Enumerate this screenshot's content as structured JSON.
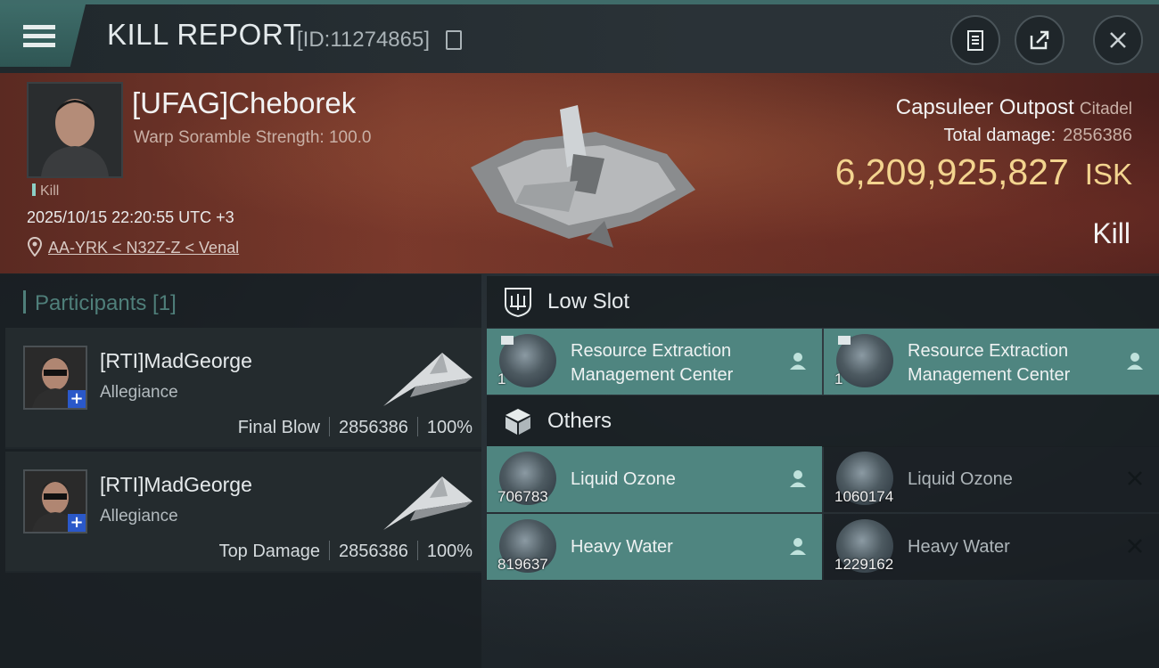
{
  "header": {
    "title": "KILL REPORT",
    "id_text": "[ID:11274865]",
    "icons": [
      "menu-icon",
      "copy-icon",
      "clipboard-icon",
      "share-icon",
      "close-icon"
    ]
  },
  "victim": {
    "name": "[UFAG]Cheborek",
    "stat_line": "Warp Soramble Strength: 100.0",
    "tag": "Kill",
    "datetime": "2025/10/15 22:20:55 UTC +3",
    "location": "AA-YRK < N32Z-Z < Venal"
  },
  "ship": {
    "name": "Capsuleer Outpost",
    "class": "Citadel",
    "total_damage_label": "Total damage:",
    "total_damage": "2856386",
    "isk_value": "6,209,925,827",
    "isk_unit": "ISK",
    "result": "Kill"
  },
  "participants": {
    "header": "Participants [1]",
    "cards": [
      {
        "name": "[RTI]MadGeorge",
        "corp": "Allegiance",
        "role": "Final Blow",
        "damage": "2856386",
        "percent": "100%"
      },
      {
        "name": "[RTI]MadGeorge",
        "corp": "Allegiance",
        "role": "Top Damage",
        "damage": "2856386",
        "percent": "100%"
      }
    ]
  },
  "low_slot": {
    "header": "Low Slot",
    "items": [
      {
        "line1": "Resource Extraction",
        "line2": "Management Center",
        "qty": "1",
        "state": "dropped"
      },
      {
        "line1": "Resource Extraction",
        "line2": "Management Center",
        "qty": "1",
        "state": "dropped"
      }
    ]
  },
  "others": {
    "header": "Others",
    "items": [
      {
        "name": "Liquid Ozone",
        "qty": "706783",
        "state": "dropped"
      },
      {
        "name": "Liquid Ozone",
        "qty": "1060174",
        "state": "destroyed"
      },
      {
        "name": "Heavy Water",
        "qty": "819637",
        "state": "dropped"
      },
      {
        "name": "Heavy Water",
        "qty": "1229162",
        "state": "destroyed"
      }
    ]
  },
  "colors": {
    "accent": "#4f8580",
    "isk": "#f3d48f",
    "banner": "#6b3226"
  }
}
